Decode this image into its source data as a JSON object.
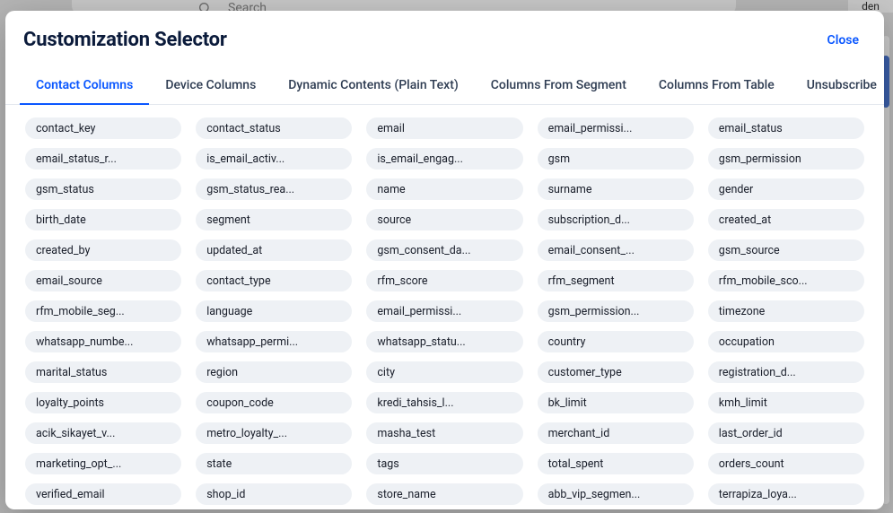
{
  "background": {
    "search_placeholder": "Search",
    "right_text": "den"
  },
  "modal": {
    "title": "Customization Selector",
    "close_label": "Close",
    "tabs": [
      {
        "label": "Contact Columns",
        "active": true
      },
      {
        "label": "Device Columns",
        "active": false
      },
      {
        "label": "Dynamic Contents (Plain Text)",
        "active": false
      },
      {
        "label": "Columns From Segment",
        "active": false
      },
      {
        "label": "Columns From Table",
        "active": false
      },
      {
        "label": "Unsubscribe",
        "active": false
      }
    ],
    "chips": [
      "contact_key",
      "contact_status",
      "email",
      "email_permissi...",
      "email_status",
      "email_status_r...",
      "is_email_activ...",
      "is_email_engag...",
      "gsm",
      "gsm_permission",
      "gsm_status",
      "gsm_status_rea...",
      "name",
      "surname",
      "gender",
      "birth_date",
      "segment",
      "source",
      "subscription_d...",
      "created_at",
      "created_by",
      "updated_at",
      "gsm_consent_da...",
      "email_consent_...",
      "gsm_source",
      "email_source",
      "contact_type",
      "rfm_score",
      "rfm_segment",
      "rfm_mobile_sco...",
      "rfm_mobile_seg...",
      "language",
      "email_permissi...",
      "gsm_permission...",
      "timezone",
      "whatsapp_numbe...",
      "whatsapp_permi...",
      "whatsapp_statu...",
      "country",
      "occupation",
      "marital_status",
      "region",
      "city",
      "customer_type",
      "registration_d...",
      "loyalty_points",
      "coupon_code",
      "kredi_tahsis_l...",
      "bk_limit",
      "kmh_limit",
      "acik_sikayet_v...",
      "metro_loyalty_...",
      "masha_test",
      "merchant_id",
      "last_order_id",
      "marketing_opt_...",
      "state",
      "tags",
      "total_spent",
      "orders_count",
      "verified_email",
      "shop_id",
      "store_name",
      "abb_vip_segmen...",
      "terrapiza_loya..."
    ]
  }
}
